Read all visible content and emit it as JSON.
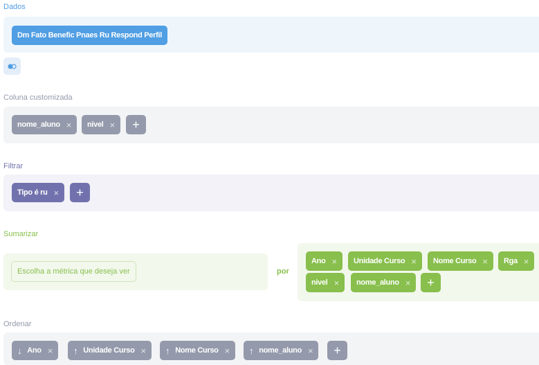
{
  "dados": {
    "title": "Dados",
    "table_label": "Dm Fato Benefic Pnaes Ru Respond Perfil"
  },
  "toggle": {
    "icon": "toggle-icon"
  },
  "custom_column": {
    "title": "Coluna customizada",
    "items": [
      {
        "label": "nome_aluno"
      },
      {
        "label": "nivel"
      }
    ],
    "add_label": "+"
  },
  "filter": {
    "title": "Filtrar",
    "items": [
      {
        "label": "Tipo é ru"
      }
    ],
    "add_label": "+"
  },
  "summarize": {
    "title": "Sumarizar",
    "metric_placeholder": "Escolha a métrica que deseja ver",
    "by_label": "por",
    "groups": [
      {
        "label": "Ano"
      },
      {
        "label": "Unidade Curso"
      },
      {
        "label": "Nome Curso"
      },
      {
        "label": "Rga"
      },
      {
        "label": "nivel"
      },
      {
        "label": "nome_aluno"
      }
    ],
    "add_label": "+"
  },
  "sort": {
    "title": "Ordenar",
    "items": [
      {
        "label": "Ano",
        "direction": "descending"
      },
      {
        "label": "Unidade Curso",
        "direction": "ascending"
      },
      {
        "label": "Nome Curso",
        "direction": "ascending"
      },
      {
        "label": "nome_aluno",
        "direction": "ascending"
      }
    ],
    "add_label": "+"
  },
  "common": {
    "remove_glyph": "×",
    "arrow_up": "↑",
    "arrow_down": "↓"
  },
  "colors": {
    "data_blue": "#509ee3",
    "gray": "#949aab",
    "purple": "#7172ad",
    "green": "#88bf4d",
    "panel_blue": "#eef6fc",
    "panel_gray": "#f3f4f6",
    "panel_purple": "#f2f2f8",
    "panel_green": "#f2f8ec"
  }
}
